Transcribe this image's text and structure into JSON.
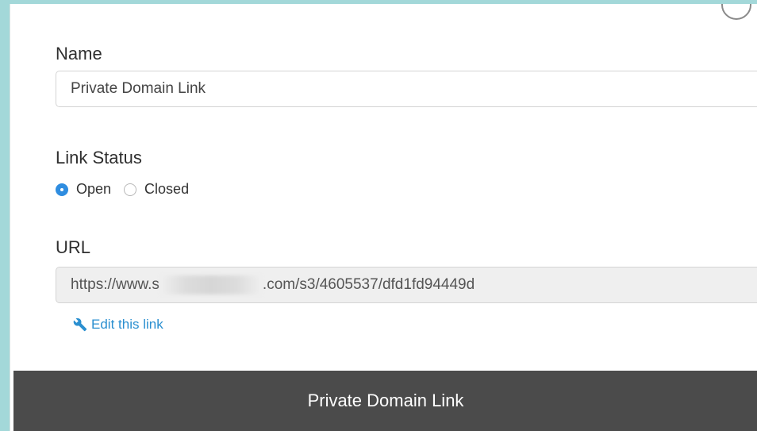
{
  "form": {
    "name_label": "Name",
    "name_value": "Private Domain Link",
    "status_label": "Link Status",
    "status_options": [
      {
        "label": "Open",
        "selected": true
      },
      {
        "label": "Closed",
        "selected": false
      }
    ],
    "url_label": "URL",
    "url_prefix": "https://www.s",
    "url_suffix": ".com/s3/4605537/dfd1fd94449d",
    "edit_link_label": "Edit this link",
    "edit_icon": "wrench-icon"
  },
  "footer": {
    "title": "Private Domain Link"
  },
  "colors": {
    "background": "#a3d8d9",
    "accent": "#2f8de0",
    "link": "#2a8fd0",
    "footer_bar": "#4b4b4b"
  }
}
